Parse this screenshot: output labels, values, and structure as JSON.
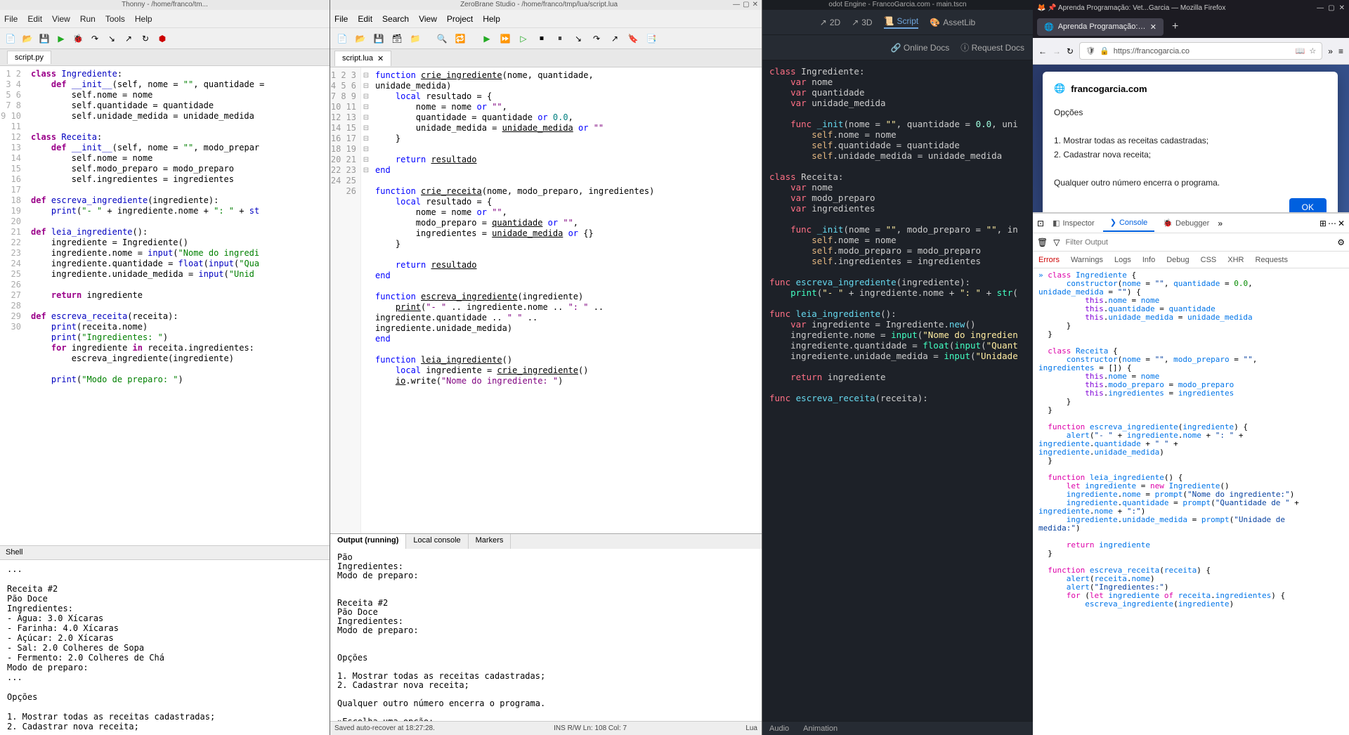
{
  "thonny": {
    "title": "Thonny - /home/franco/tm...",
    "menu": [
      "File",
      "Edit",
      "View",
      "Run",
      "Tools",
      "Help"
    ],
    "tab": "script.py",
    "lines": [
      "1",
      "2",
      "3",
      "4",
      "5",
      "6",
      "7",
      "8",
      "9",
      "10",
      "11",
      "12",
      "13",
      "14",
      "15",
      "16",
      "17",
      "18",
      "19",
      "20",
      "21",
      "22",
      "23",
      "24",
      "25",
      "26",
      "27",
      "28",
      "29",
      "30"
    ],
    "shell_label": "Shell",
    "shell": "...\n\nReceita #2\nPão Doce\nIngredientes:\n- Água: 3.0 Xícaras\n- Farinha: 4.0 Xícaras\n- Açúcar: 2.0 Xícaras\n- Sal: 2.0 Colheres de Sopa\n- Fermento: 2.0 Colheres de Chá\nModo de preparo:\n...\n\nOpções\n\n1. Mostrar todas as receitas cadastradas;\n2. Cadastrar nova receita;\n\nQualquer outro número encerra o programa.\n\nEscolha uma opção:"
  },
  "zerobrane": {
    "title": "ZeroBrane Studio - /home/franco/tmp/lua/script.lua",
    "menu": [
      "File",
      "Edit",
      "Search",
      "View",
      "Project",
      "Help"
    ],
    "tab": "script.lua",
    "lines": [
      "1",
      "2",
      "3",
      "4",
      "5",
      "6",
      "7",
      "8",
      "9",
      "10",
      "11",
      "12",
      "13",
      "14",
      "15",
      "16",
      "17",
      "18",
      "19",
      "20",
      "21",
      "22",
      "23",
      "24",
      "25",
      "26"
    ],
    "output_tabs": [
      "Output (running)",
      "Local console",
      "Markers"
    ],
    "output": "Pão\nIngredientes:\nModo de preparo:\n\n\nReceita #2\nPão Doce\nIngredientes:\nModo de preparo:\n\n\nOpções\n\n1. Mostrar todas as receitas cadastradas;\n2. Cadastrar nova receita;\n\nQualquer outro número encerra o programa.\n\n»Escolha uma opção:",
    "status_left": "Saved auto-recover at 18:27:28.",
    "status_mid": "INS    R/W    Ln: 108 Col: 7",
    "status_right": "Lua"
  },
  "godot": {
    "title": "odot Engine - FrancoGarcia.com - main.tscn",
    "tabs": {
      "t2d": "2D",
      "t3d": "3D",
      "tscript": "Script",
      "tasset": "AssetLib"
    },
    "subtabs": {
      "online": "Online Docs",
      "request": "Request Docs"
    },
    "bottom": {
      "audio": "Audio",
      "anim": "Animation"
    }
  },
  "firefox": {
    "title": "Aprenda Programação: Vet...Garcia — Mozilla Firefox",
    "tab": "Aprenda Programação: Vetor",
    "url": "https://francogarcia.co",
    "dialog": {
      "host": "francogarcia.com",
      "l1": "Opções",
      "l2": "1. Mostrar todas as receitas cadastradas;",
      "l3": "2. Cadastrar nova receita;",
      "l4": "Qualquer outro número encerra o programa.",
      "ok": "OK"
    },
    "devtools": {
      "tabs": {
        "inspector": "Inspector",
        "console": "Console",
        "debugger": "Debugger"
      },
      "filter_placeholder": "Filter Output",
      "cats": [
        "Errors",
        "Warnings",
        "Logs",
        "Info",
        "Debug",
        "CSS",
        "XHR",
        "Requests"
      ]
    }
  },
  "chart_data": null
}
